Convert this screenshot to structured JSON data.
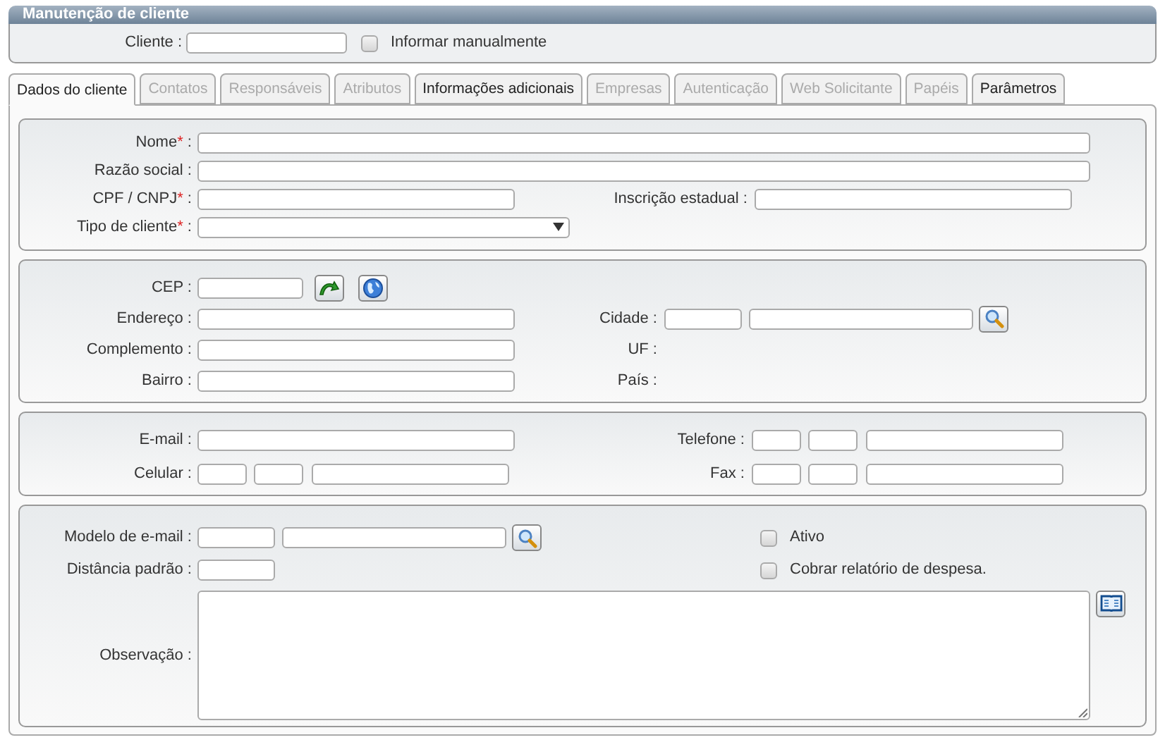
{
  "header": {
    "title": "Manutenção de cliente",
    "client_label": "Cliente :",
    "manual_checkbox": {
      "label": "Informar manualmente",
      "checked": false
    }
  },
  "tabs": [
    {
      "label": "Dados do cliente",
      "selected": true,
      "disabled": false
    },
    {
      "label": "Contatos",
      "selected": false,
      "disabled": true
    },
    {
      "label": "Responsáveis",
      "selected": false,
      "disabled": true
    },
    {
      "label": "Atributos",
      "selected": false,
      "disabled": true
    },
    {
      "label": "Informações adicionais",
      "selected": false,
      "disabled": false
    },
    {
      "label": "Empresas",
      "selected": false,
      "disabled": true
    },
    {
      "label": "Autenticação",
      "selected": false,
      "disabled": true
    },
    {
      "label": "Web Solicitante",
      "selected": false,
      "disabled": true
    },
    {
      "label": "Papéis",
      "selected": false,
      "disabled": true
    },
    {
      "label": "Parâmetros",
      "selected": false,
      "disabled": false
    }
  ],
  "sections": [
    {
      "rows": [
        {
          "left": {
            "label": "Nome",
            "required_mark": "*",
            "colon": ":",
            "kind": "wide"
          }
        },
        {
          "left": {
            "label": "Razão social",
            "colon": ":",
            "kind": "wide"
          }
        },
        {
          "left": {
            "label": "CPF / CNPJ",
            "required_mark": "*",
            "colon": ":",
            "kind": "medium"
          },
          "right": {
            "label": "Inscrição estadual",
            "colon": ":",
            "kind": "medium"
          }
        },
        {
          "left": {
            "label": "Tipo de cliente",
            "required_mark": "*",
            "colon": ":",
            "kind": "select"
          }
        }
      ]
    },
    {
      "rows": [
        {
          "left": {
            "label": "CEP",
            "colon": ":",
            "kind": "cep"
          }
        },
        {
          "left": {
            "label": "Endereço",
            "colon": ":",
            "kind": "medium"
          },
          "right": {
            "label": "Cidade",
            "colon": ":",
            "kind": "city"
          }
        },
        {
          "left": {
            "label": "Complemento",
            "colon": ":",
            "kind": "medium"
          },
          "right": {
            "label": "UF",
            "colon": ":",
            "kind": "static"
          }
        },
        {
          "left": {
            "label": "Bairro",
            "colon": ":",
            "kind": "medium"
          },
          "right": {
            "label": "País",
            "colon": ":",
            "kind": "static"
          }
        }
      ]
    },
    {
      "rows": [
        {
          "left": {
            "label": "E-mail",
            "colon": ":",
            "kind": "medium"
          },
          "right": {
            "label": "Telefone",
            "colon": ":",
            "kind": "phone"
          }
        },
        {
          "left": {
            "label": "Celular",
            "colon": ":",
            "kind": "phone"
          },
          "right": {
            "label": "Fax",
            "colon": ":",
            "kind": "phone"
          }
        }
      ]
    },
    {
      "rows": [
        {
          "left": {
            "label": "Modelo de e-mail",
            "colon": ":",
            "kind": "model"
          },
          "right": {
            "label": "Ativo",
            "kind": "checkbox",
            "checked": false
          }
        },
        {
          "left": {
            "label": "Distância padrão",
            "colon": ":",
            "kind": "short"
          },
          "right": {
            "label": "Cobrar relatório de despesa.",
            "kind": "checkbox",
            "checked": false
          }
        },
        {
          "left": {
            "label": "Observação",
            "colon": ":",
            "kind": "textarea"
          }
        }
      ]
    }
  ]
}
